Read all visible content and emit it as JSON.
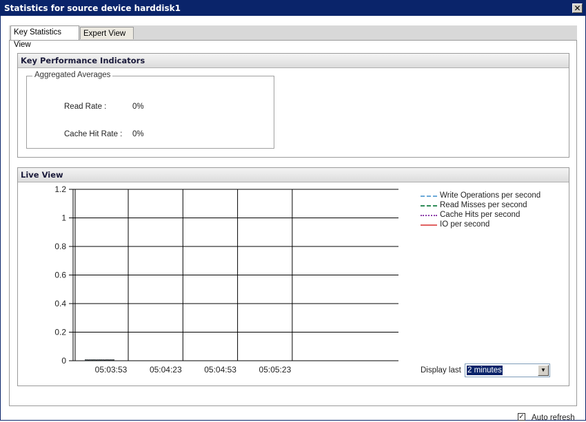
{
  "window": {
    "title": "Statistics for source device harddisk1",
    "close_glyph": "✕"
  },
  "tabs": [
    {
      "label": "Key Statistics View",
      "active": true
    },
    {
      "label": "Expert View",
      "active": false
    }
  ],
  "kpi_panel": {
    "title": "Key Performance Indicators",
    "group_title": "Aggregated Averages",
    "rows": [
      {
        "label": "Read Rate :",
        "value": "0%"
      },
      {
        "label": "Cache Hit Rate  :",
        "value": "0%"
      }
    ]
  },
  "live_panel": {
    "title": "Live View",
    "legend": [
      {
        "label": "Write Operations per second",
        "color": "#6aa9d8",
        "style": "dashed"
      },
      {
        "label": "Read Misses per second",
        "color": "#2e8b57",
        "style": "dashdot"
      },
      {
        "label": "Cache Hits per second",
        "color": "#8b3aa8",
        "style": "dotted"
      },
      {
        "label": "IO per second",
        "color": "#e06060",
        "style": "solid"
      }
    ],
    "display_last_label": "Display last",
    "display_last_value": "2 minutes",
    "auto_refresh_label": "Auto refresh",
    "auto_refresh_checked": true
  },
  "chart_data": {
    "type": "line",
    "title": "",
    "xlabel": "",
    "ylabel": "",
    "ylim": [
      0,
      1.2
    ],
    "y_ticks": [
      "0",
      "0.2",
      "0.4",
      "0.6",
      "0.8",
      "1",
      "1.2"
    ],
    "x_ticks": [
      "05:03:53",
      "05:04:23",
      "05:04:53",
      "05:05:23"
    ],
    "grid": true,
    "series": [
      {
        "name": "Write Operations per second",
        "values": [
          0,
          0
        ]
      },
      {
        "name": "Read Misses per second",
        "values": [
          0,
          0
        ]
      },
      {
        "name": "Cache Hits per second",
        "values": [
          0,
          0
        ]
      },
      {
        "name": "IO per second",
        "values": [
          0,
          0
        ]
      }
    ]
  }
}
